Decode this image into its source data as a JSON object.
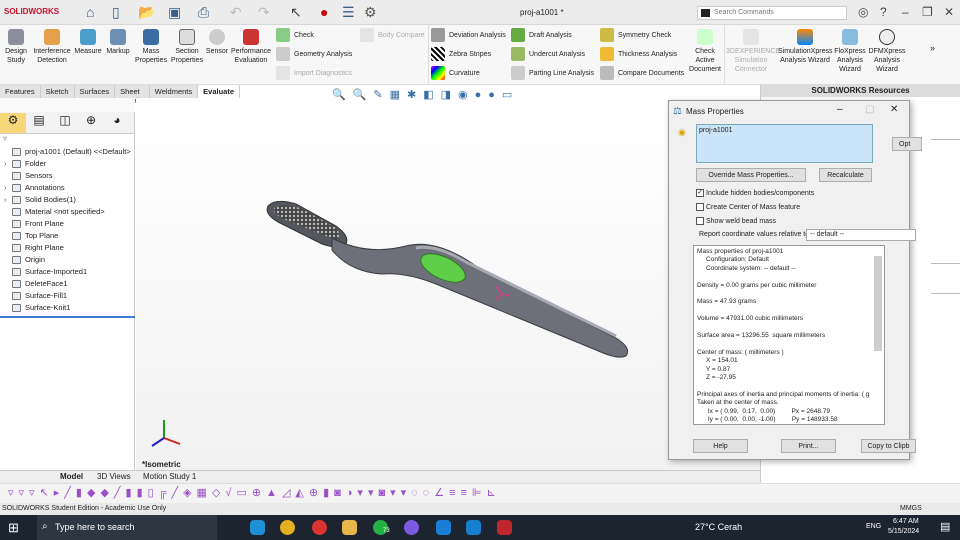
{
  "app": {
    "logo": "SOLIDWORKS",
    "document_title": "proj-a1001 *",
    "search_placeholder": "Search Commands"
  },
  "ribbon": {
    "large": [
      {
        "label": "Design Study"
      },
      {
        "label": "Interference Detection"
      },
      {
        "label": "Measure"
      },
      {
        "label": "Markup"
      },
      {
        "label": "Mass Properties"
      },
      {
        "label": "Section Properties"
      },
      {
        "label": "Sensor"
      },
      {
        "label": "Performance Evaluation"
      }
    ],
    "col1": [
      {
        "label": "Check"
      },
      {
        "label": "Geometry Analysis"
      },
      {
        "label": "Import Diagnostics"
      }
    ],
    "body_compare": "Body Compare",
    "col2": [
      {
        "label": "Deviation Analysis"
      },
      {
        "label": "Zebra Stripes"
      },
      {
        "label": "Curvature"
      }
    ],
    "col3": [
      {
        "label": "Draft Analysis"
      },
      {
        "label": "Undercut Analysis"
      },
      {
        "label": "Parting Line Analysis"
      }
    ],
    "col4": [
      {
        "label": "Symmetry Check"
      },
      {
        "label": "Thickness Analysis"
      },
      {
        "label": "Compare Documents"
      }
    ],
    "large2": [
      {
        "label": "Check Active Document"
      },
      {
        "label": "3DEXPERIENCE Simulation Connector"
      },
      {
        "label": "SimulationXpress Analysis Wizard"
      },
      {
        "label": "FloXpress Analysis Wizard"
      },
      {
        "label": "DFMXpress Analysis Wizard"
      }
    ]
  },
  "command_tabs": [
    "Features",
    "Sketch",
    "Surfaces",
    "Sheet Metal",
    "Weldments",
    "Evaluate"
  ],
  "tree": [
    {
      "label": "proj-a1001 (Default) <<Default>"
    },
    {
      "label": "Folder",
      "exp": true
    },
    {
      "label": "Sensors"
    },
    {
      "label": "Annotations",
      "exp": true
    },
    {
      "label": "Solid Bodies(1)",
      "exp": true
    },
    {
      "label": "Material <not specified>"
    },
    {
      "label": "Front Plane"
    },
    {
      "label": "Top Plane"
    },
    {
      "label": "Right Plane"
    },
    {
      "label": "Origin"
    },
    {
      "label": "Surface-Imported1"
    },
    {
      "label": "DeleteFace1"
    },
    {
      "label": "Surface-Fill1"
    },
    {
      "label": "Surface-Knit1"
    }
  ],
  "viewport": {
    "view_label": "*Isometric"
  },
  "task_pane": {
    "title": "SOLIDWORKS Resources"
  },
  "dialog": {
    "title": "Mass Properties",
    "selection": "proj-a1001",
    "override": "Override Mass Properties...",
    "recalculate": "Recalculate",
    "options": "Opt",
    "include_hidden": "Include hidden bodies/components",
    "create_com": "Create Center of Mass feature",
    "show_weld": "Show weld bead mass",
    "report_label": "Report coordinate values relative to:",
    "report_value": "-- default --",
    "output": "Mass properties of proj-a1001\n     Configuration: Default\n     Coordinate system: -- default --\n\nDensity = 0.00 grams per cubic millimeter\n\nMass = 47.93 grams\n\nVolume = 47931.00 cubic millimeters\n\nSurface area = 13296.55  square millimeters\n\nCenter of mass: ( millimeters )\n     X = 154.01\n     Y = 0.87\n     Z = -27.95\n\nPrincipal axes of inertia and principal moments of inertia: ( g\nTaken at the center of mass.\n      Ix = ( 0.99,  0.17,  0.00)         Px = 2648.79\n      Iy = ( 0.00,  0.00, -1.00)         Py = 148933.58",
    "help": "Help",
    "print": "Print...",
    "copy": "Copy to Clipb"
  },
  "bottom_tabs": [
    "Model",
    "3D Views",
    "Motion Study 1"
  ],
  "status": {
    "left": "SOLIDWORKS Student Edition - Academic Use Only",
    "units": "MMGS"
  },
  "taskbar": {
    "search": "Type here to search",
    "weather": "27°C  Cerah",
    "lang": "ENG",
    "time": "6:47 AM",
    "date": "5/15/2024",
    "whatsapp_badge": "73"
  }
}
